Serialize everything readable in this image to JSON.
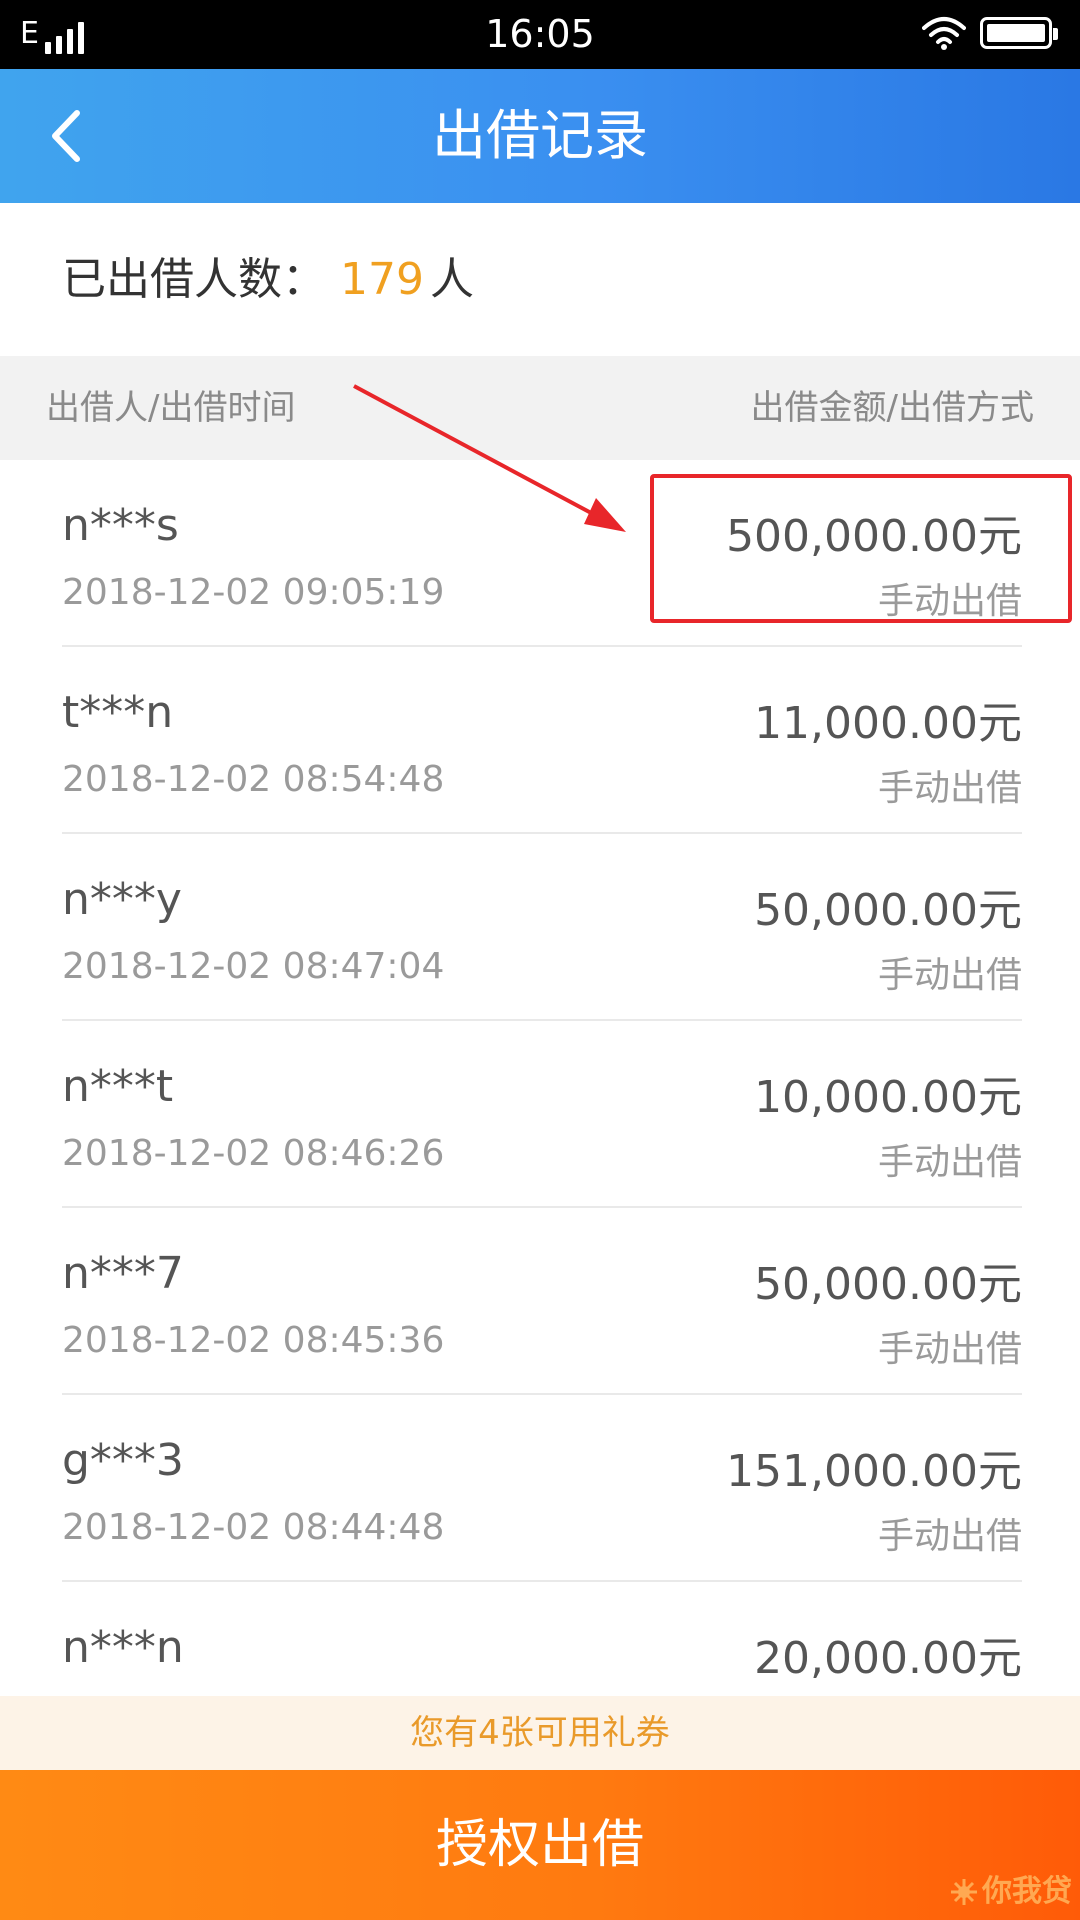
{
  "status_bar": {
    "network_type": "E",
    "time": "16:05"
  },
  "header": {
    "title": "出借记录",
    "back_icon": "chevron-left-icon"
  },
  "summary": {
    "label": "已出借人数：",
    "count": "179",
    "unit": "人"
  },
  "table": {
    "left_header": "出借人/出借时间",
    "right_header": "出借金额/出借方式",
    "rows": [
      {
        "name": "n***s",
        "time": "2018-12-02 09:05:19",
        "amount": "500,000.00元",
        "method": "手动出借"
      },
      {
        "name": "t***n",
        "time": "2018-12-02 08:54:48",
        "amount": "11,000.00元",
        "method": "手动出借"
      },
      {
        "name": "n***y",
        "time": "2018-12-02 08:47:04",
        "amount": "50,000.00元",
        "method": "手动出借"
      },
      {
        "name": "n***t",
        "time": "2018-12-02 08:46:26",
        "amount": "10,000.00元",
        "method": "手动出借"
      },
      {
        "name": "n***7",
        "time": "2018-12-02 08:45:36",
        "amount": "50,000.00元",
        "method": "手动出借"
      },
      {
        "name": "g***3",
        "time": "2018-12-02 08:44:48",
        "amount": "151,000.00元",
        "method": "手动出借"
      },
      {
        "name": "n***n",
        "time": "",
        "amount": "20,000.00元",
        "method": ""
      }
    ]
  },
  "coupon": {
    "text": "您有4张可用礼券"
  },
  "footer": {
    "button_label": "授权出借",
    "watermark_text": "你我贷"
  },
  "colors": {
    "header_blue": "#3a8ff0",
    "count_orange": "#f0a020",
    "button_orange": "#ff7a10",
    "annotation_red": "#e8262a"
  }
}
